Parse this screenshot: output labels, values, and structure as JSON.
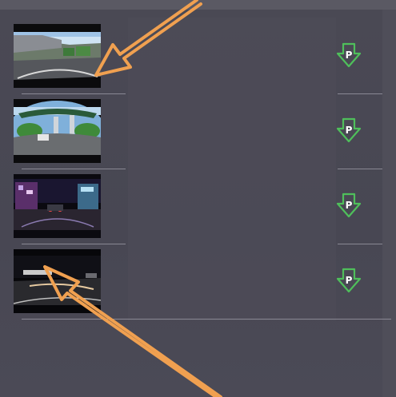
{
  "window": {
    "title": ""
  },
  "video_list": {
    "items": [
      {
        "thumbnail": "dashcam-daytime-overpass",
        "action_icon": "download-p-icon"
      },
      {
        "thumbnail": "dashcam-fisheye-intersection",
        "action_icon": "download-p-icon"
      },
      {
        "thumbnail": "dashcam-night-street-neon",
        "action_icon": "download-p-icon"
      },
      {
        "thumbnail": "dashcam-night-dark-road",
        "action_icon": "download-p-icon"
      }
    ],
    "download_glyph": "P"
  },
  "annotations": {
    "arrow_color": "#f08a2c",
    "arrow_count": 2
  },
  "colors": {
    "background": "#4a4954",
    "download_icon": "#4fbf5b",
    "divider": "#9a99a4",
    "arrow": "#f08a2c"
  }
}
